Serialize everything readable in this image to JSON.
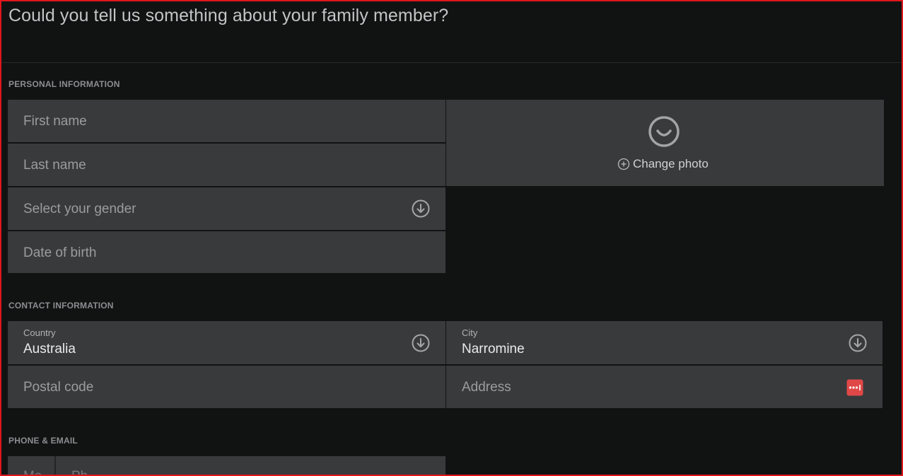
{
  "page": {
    "title": "Could you tell us something about your family member?"
  },
  "personal": {
    "section_label": "PERSONAL INFORMATION",
    "first_name_placeholder": "First name",
    "last_name_placeholder": "Last name",
    "gender_placeholder": "Select your gender",
    "dob_placeholder": "Date of birth",
    "change_photo_label": "Change photo"
  },
  "contact": {
    "section_label": "CONTACT INFORMATION",
    "country_label": "Country",
    "country_value": "Australia",
    "city_label": "City",
    "city_value": "Narromine",
    "postal_placeholder": "Postal code",
    "address_placeholder": "Address"
  },
  "phone_email": {
    "section_label": "PHONE & EMAIL",
    "prefix_placeholder_cut": "Ma",
    "phone_placeholder_cut": "Ph"
  },
  "colors": {
    "accent_border": "#e0161b",
    "field_bg": "#393a3c",
    "page_bg": "#111313",
    "password_icon": "#e04848"
  }
}
